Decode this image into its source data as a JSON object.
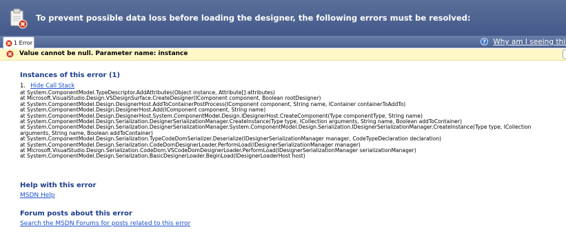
{
  "header": {
    "message": "To prevent possible data loss before loading the designer, the following errors must be resolved:"
  },
  "tabs": [
    {
      "label": "1 Error"
    }
  ],
  "why_link": "Why am I seeing this page",
  "error_summary": "Value cannot be null. Parameter name: instance",
  "instances": {
    "heading": "Instances of this error (1)",
    "number": "1.",
    "toggle_label": "Hide Call Stack",
    "stack": [
      "at System.ComponentModel.TypeDescriptor.AddAttributes(Object instance, Attribute[] attributes)",
      "at Microsoft.VisualStudio.Design.VSDesignSurface.CreateDesigner(IComponent component, Boolean rootDesigner)",
      "at System.ComponentModel.Design.DesignerHost.AddToContainerPostProcess(IComponent component, String name, IContainer containerToAddTo)",
      "at System.ComponentModel.Design.DesignerHost.Add(IComponent component, String name)",
      "at System.ComponentModel.Design.DesignerHost.System.ComponentModel.Design.IDesignerHost.CreateComponent(Type componentType, String name)",
      "at System.ComponentModel.Design.Serialization.DesignerSerializationManager.CreateInstance(Type type, ICollection arguments, String name, Boolean addToContainer)",
      "at System.ComponentModel.Design.Serialization.DesignerSerializationManager.System.ComponentModel.Design.Serialization.IDesignerSerializationManager.CreateInstance(Type type, ICollection arguments, String name, Boolean addToContainer)",
      "at System.ComponentModel.Design.Serialization.TypeCodeDomSerializer.Deserialize(IDesignerSerializationManager manager, CodeTypeDeclaration declaration)",
      "at System.ComponentModel.Design.Serialization.CodeDomDesignerLoader.PerformLoad(IDesignerSerializationManager manager)",
      "at Microsoft.VisualStudio.Design.Serialization.CodeDom.VSCodeDomDesignerLoader.PerformLoad(IDesignerSerializationManager serializationManager)",
      "at System.ComponentModel.Design.Serialization.BasicDesignerLoader.BeginLoad(IDesignerLoaderHost host)"
    ]
  },
  "help": {
    "heading": "Help with this error",
    "link": "MSDN Help"
  },
  "forum": {
    "heading": "Forum posts about this error",
    "link": "Search the MSDN Forums for posts related to this error"
  },
  "colors": {
    "banner": "#44598a",
    "heading": "#1a3c8c",
    "link": "#1a4fcc",
    "error_bar": "#fff7c8",
    "error_red": "#d43a1c"
  }
}
